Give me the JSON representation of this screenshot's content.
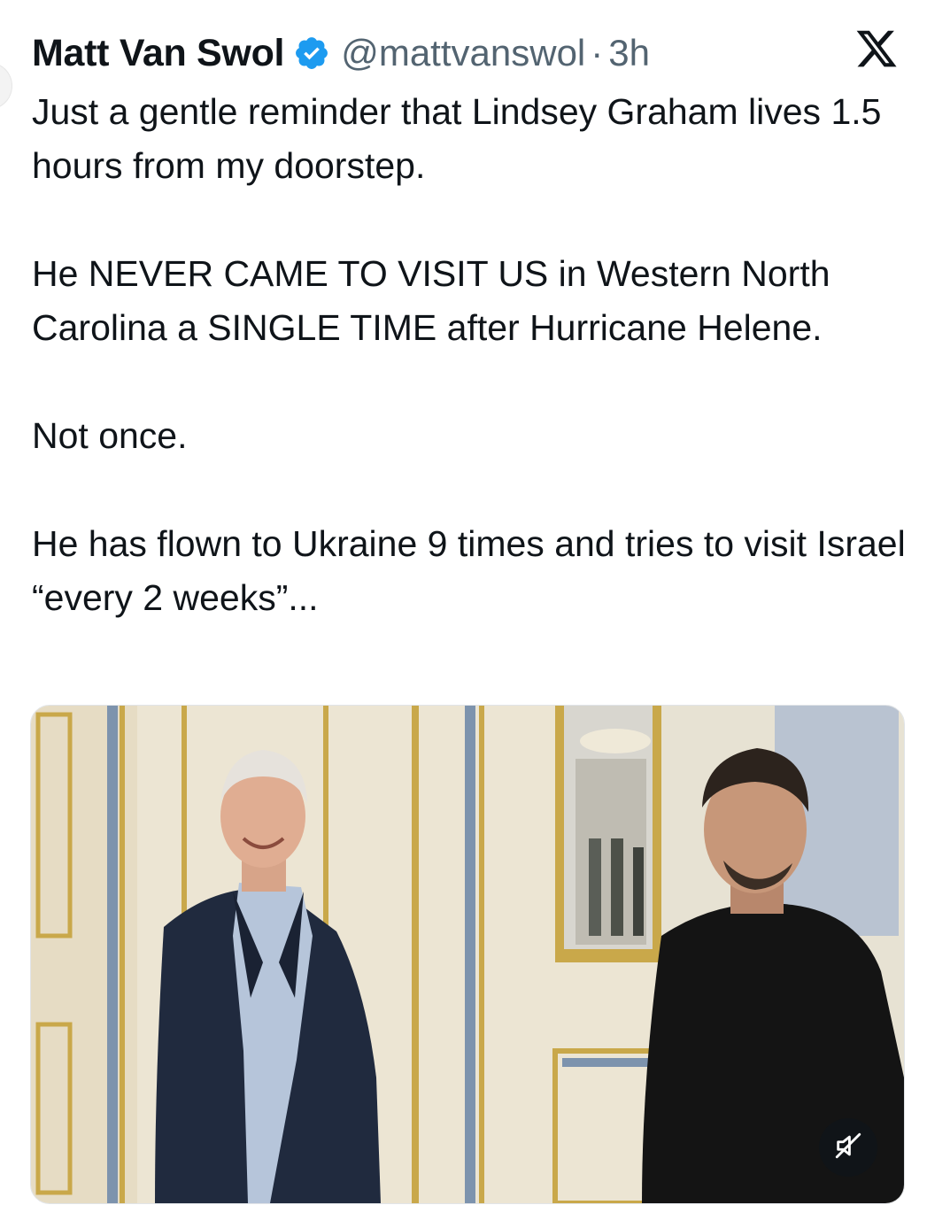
{
  "author": {
    "name": "Matt Van Swol",
    "handle": "@mattvanswol",
    "separator": "·",
    "time": "3h"
  },
  "tweet": {
    "paragraphs": [
      "Just a gentle reminder that Lindsey Graham lives 1.5 hours from my doorstep.",
      "He NEVER CAME TO VISIT US in Western North Carolina a SINGLE TIME after Hurricane Helene.",
      "Not once.",
      "He has flown to Ukraine 9 times and tries to visit Israel “every 2 weeks”..."
    ]
  },
  "icons": {
    "verified": "verified-badge-icon",
    "brand": "x-logo-icon",
    "mute": "speaker-muted-icon"
  },
  "colors": {
    "verified_blue": "#1d9bf0",
    "text_primary": "#0f1419",
    "text_secondary": "#536471"
  }
}
